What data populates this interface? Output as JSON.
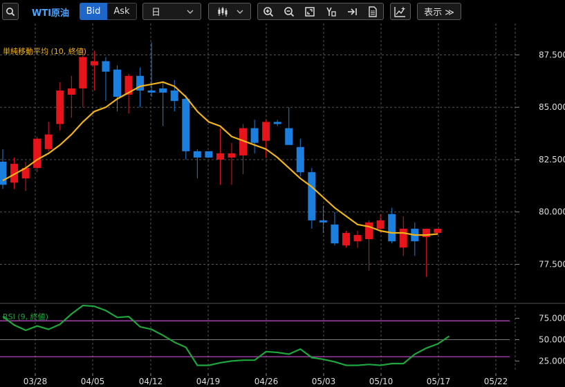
{
  "toolbar": {
    "symbol": "WTI原油",
    "bid_label": "Bid",
    "ask_label": "Ask",
    "timeframe": "日",
    "display_label": "表示 ≫",
    "icons": [
      "zoom-in-icon",
      "zoom-out-icon",
      "fit-icon",
      "cursor-text-icon",
      "jump-latest-icon",
      "document-icon",
      "add-indicator-icon"
    ]
  },
  "colors": {
    "up": "#e8141c",
    "down": "#1b7fe0",
    "ma": "#f0b418",
    "rsi": "#1ea63c",
    "rsi_band": "#c74fcf"
  },
  "chart_data": [
    {
      "type": "candlestick",
      "overlay_label": "単純移動平均 (10, 終値)",
      "ylim": [
        75.8,
        89.0
      ],
      "yticks": [
        "87.500",
        "85.000",
        "82.500",
        "80.000",
        "77.500"
      ],
      "xticks": [
        "03/28",
        "04/05",
        "04/12",
        "04/19",
        "04/26",
        "05/03",
        "05/10",
        "05/17",
        "05/22"
      ],
      "candles": [
        {
          "o": 82.4,
          "h": 83.0,
          "l": 81.1,
          "c": 81.3
        },
        {
          "o": 81.4,
          "h": 82.6,
          "l": 81.1,
          "c": 82.3
        },
        {
          "o": 81.6,
          "h": 82.4,
          "l": 81.0,
          "c": 82.1
        },
        {
          "o": 82.1,
          "h": 83.6,
          "l": 81.9,
          "c": 83.5
        },
        {
          "o": 83.0,
          "h": 84.3,
          "l": 82.9,
          "c": 83.7
        },
        {
          "o": 84.2,
          "h": 86.2,
          "l": 83.9,
          "c": 85.8
        },
        {
          "o": 85.6,
          "h": 86.5,
          "l": 84.5,
          "c": 85.9
        },
        {
          "o": 85.9,
          "h": 87.8,
          "l": 85.0,
          "c": 87.4
        },
        {
          "o": 87.0,
          "h": 87.7,
          "l": 85.8,
          "c": 87.2
        },
        {
          "o": 87.2,
          "h": 87.4,
          "l": 85.3,
          "c": 86.7
        },
        {
          "o": 86.8,
          "h": 87.0,
          "l": 84.8,
          "c": 85.5
        },
        {
          "o": 85.6,
          "h": 86.6,
          "l": 84.7,
          "c": 86.5
        },
        {
          "o": 86.5,
          "h": 86.9,
          "l": 85.0,
          "c": 85.8
        },
        {
          "o": 85.8,
          "h": 88.1,
          "l": 85.5,
          "c": 85.7
        },
        {
          "o": 85.9,
          "h": 86.2,
          "l": 84.1,
          "c": 85.7
        },
        {
          "o": 85.8,
          "h": 86.3,
          "l": 84.8,
          "c": 85.3
        },
        {
          "o": 85.4,
          "h": 85.6,
          "l": 82.5,
          "c": 82.9
        },
        {
          "o": 82.9,
          "h": 83.0,
          "l": 81.6,
          "c": 82.6
        },
        {
          "o": 82.9,
          "h": 82.9,
          "l": 82.6,
          "c": 82.6
        },
        {
          "o": 82.5,
          "h": 84.0,
          "l": 81.3,
          "c": 82.8
        },
        {
          "o": 82.6,
          "h": 83.3,
          "l": 81.3,
          "c": 82.8
        },
        {
          "o": 82.7,
          "h": 84.2,
          "l": 81.8,
          "c": 84.0
        },
        {
          "o": 84.0,
          "h": 84.4,
          "l": 82.8,
          "c": 83.3
        },
        {
          "o": 83.4,
          "h": 84.4,
          "l": 82.6,
          "c": 84.3
        },
        {
          "o": 84.3,
          "h": 84.4,
          "l": 84.1,
          "c": 84.2
        },
        {
          "o": 84.0,
          "h": 85.0,
          "l": 83.2,
          "c": 83.2
        },
        {
          "o": 83.1,
          "h": 83.5,
          "l": 81.7,
          "c": 81.9
        },
        {
          "o": 81.9,
          "h": 82.1,
          "l": 79.2,
          "c": 79.6
        },
        {
          "o": 79.6,
          "h": 80.3,
          "l": 79.0,
          "c": 79.5
        },
        {
          "o": 79.4,
          "h": 80.0,
          "l": 78.4,
          "c": 78.5
        },
        {
          "o": 78.4,
          "h": 79.1,
          "l": 78.3,
          "c": 79.0
        },
        {
          "o": 78.6,
          "h": 79.1,
          "l": 78.3,
          "c": 78.9
        },
        {
          "o": 78.7,
          "h": 79.6,
          "l": 77.2,
          "c": 79.5
        },
        {
          "o": 79.2,
          "h": 79.9,
          "l": 79.0,
          "c": 79.6
        },
        {
          "o": 79.9,
          "h": 80.2,
          "l": 78.5,
          "c": 78.6
        },
        {
          "o": 78.3,
          "h": 79.8,
          "l": 77.9,
          "c": 79.2
        },
        {
          "o": 79.2,
          "h": 79.5,
          "l": 77.9,
          "c": 78.6
        },
        {
          "o": 78.8,
          "h": 79.2,
          "l": 76.9,
          "c": 79.2
        },
        {
          "o": 79.0,
          "h": 79.2,
          "l": 78.9,
          "c": 79.2
        }
      ],
      "ma": [
        81.5,
        81.8,
        82.1,
        82.5,
        82.8,
        83.2,
        83.7,
        84.3,
        84.8,
        85.0,
        85.4,
        85.7,
        86.0,
        86.1,
        86.2,
        86.0,
        85.5,
        84.8,
        84.3,
        84.1,
        83.6,
        83.4,
        83.2,
        83.0,
        82.6,
        82.1,
        81.6,
        81.2,
        80.7,
        80.2,
        79.8,
        79.4,
        79.3,
        79.1,
        79.0,
        79.0,
        78.9,
        78.9,
        78.95
      ],
      "grid": true
    },
    {
      "type": "line",
      "overlay_label": "RSI (9, 終値)",
      "ylim": [
        14,
        90
      ],
      "yticks": [
        "75.000",
        "50.000",
        "25.000"
      ],
      "bands": [
        72,
        30
      ],
      "midline": 50,
      "values": [
        77,
        67,
        61,
        66,
        62,
        68,
        80,
        90,
        89,
        84,
        76,
        77,
        65,
        62,
        55,
        47,
        41,
        20,
        20,
        23,
        25,
        26,
        26,
        36,
        35,
        33,
        39,
        29,
        27,
        24,
        20,
        20,
        21,
        20,
        22,
        22,
        33,
        40,
        45,
        54
      ],
      "grid": true
    }
  ]
}
